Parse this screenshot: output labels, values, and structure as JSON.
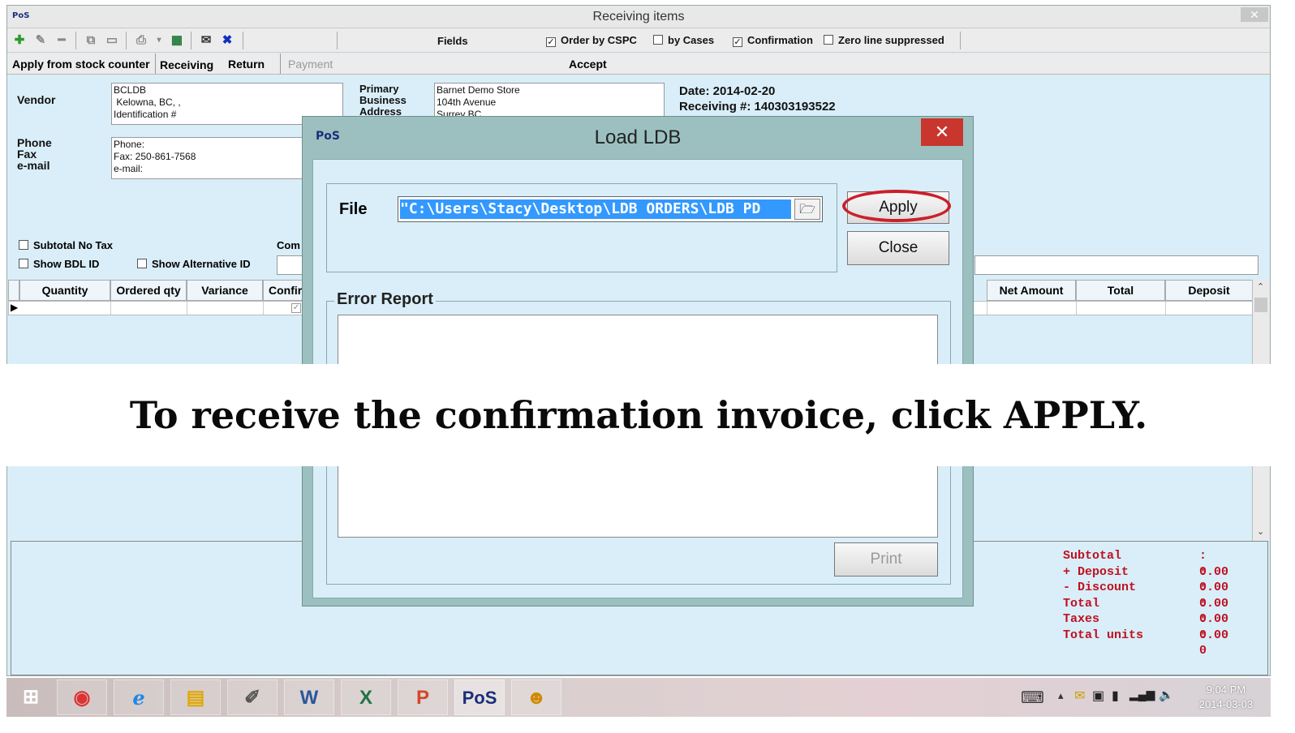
{
  "window": {
    "title": "Receiving items",
    "logo": "PoS",
    "close": "✕"
  },
  "toolbar": {
    "fields_label": "Fields",
    "order_by_cspc": "Order by CSPC",
    "by_cases": "by Cases",
    "confirmation": "Confirmation",
    "zero_line": "Zero line suppressed",
    "order_by_cspc_checked": true,
    "by_cases_checked": false,
    "confirmation_checked": true,
    "zero_line_checked": false
  },
  "tabs": [
    "Apply from stock counter",
    "Receiving",
    "Return",
    "Payment",
    "Accept"
  ],
  "vendor": {
    "label": "Vendor",
    "lines": [
      "BCLDB",
      " Kelowna, BC, ,",
      "Identification #"
    ]
  },
  "contact": {
    "phone_label": "Phone",
    "fax_label": "Fax",
    "email_label": "e-mail",
    "lines": [
      "Phone:",
      "Fax: 250-861-7568",
      "e-mail:"
    ]
  },
  "primary": {
    "label_lines": [
      "Primary",
      "Business",
      "Address"
    ],
    "lines": [
      "Barnet Demo Store",
      "104th Avenue",
      "Surrey BC"
    ]
  },
  "info": {
    "date": "Date: 2014-02-20",
    "receiving": "Receiving #: 140303193522"
  },
  "options": {
    "subtotal_no_tax": "Subtotal No Tax",
    "show_bdl_id": "Show BDL ID",
    "show_alt_id": "Show Alternative ID",
    "comments_partial": "Com"
  },
  "grid": {
    "columns_left": [
      "Quantity",
      "Ordered qty",
      "Variance",
      "Confir"
    ],
    "columns_right": [
      "Net Amount",
      "Total",
      "Deposit"
    ]
  },
  "totals": [
    {
      "label": "Subtotal",
      "value": ": 0.00"
    },
    {
      "label": "+ Deposit",
      "value": ": 0.00"
    },
    {
      "label": "- Discount",
      "value": ": 0.00"
    },
    {
      "label": "Total",
      "value": ": 0.00"
    },
    {
      "label": "Taxes",
      "value": ": 0.00"
    },
    {
      "label": "Total units",
      "value": ": 0"
    }
  ],
  "dialog": {
    "title": "Load LDB",
    "logo": "PoS",
    "close": "✕",
    "file_label": "File",
    "file_value": "\"C:\\Users\\Stacy\\Desktop\\LDB ORDERS\\LDB PD",
    "apply_label": "Apply",
    "close_label": "Close",
    "error_report_label": "Error Report",
    "print_label": "Print"
  },
  "banner": {
    "text": "To receive the confirmation invoice, click APPLY."
  },
  "taskbar": {
    "pos_label": "PoS",
    "time": "9:04 PM",
    "date": "2014-03-03"
  },
  "colors": {
    "highlight": "#cc1f2a",
    "selection": "#3399ff",
    "panel": "#d9eef8"
  }
}
